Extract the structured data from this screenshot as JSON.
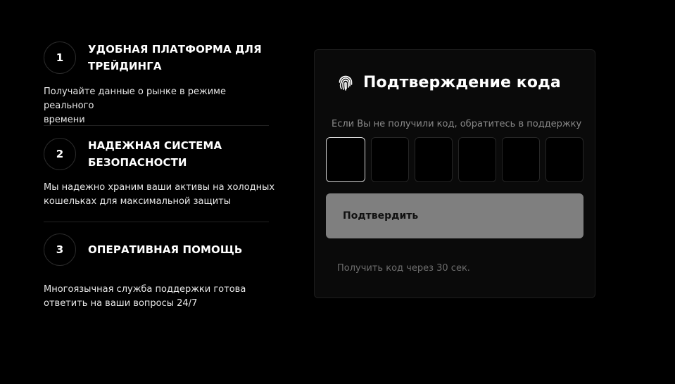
{
  "features": [
    {
      "number": "1",
      "title_line1": "УДОБНАЯ ПЛАТФОРМА ДЛЯ",
      "title_line2": "ТРЕЙДИНГА",
      "desc_line1": "Получайте данные о рынке в режиме реального",
      "desc_line2": "времени"
    },
    {
      "number": "2",
      "title_line1": "НАДЕЖНАЯ СИСТЕМА",
      "title_line2": "БЕЗОПАСНОСТИ",
      "desc_line1": "Мы надежно храним ваши активы на холодных",
      "desc_line2": "кошельках для максимальной защиты"
    },
    {
      "number": "3",
      "title_line1": "ОПЕРАТИВНАЯ ПОМОЩЬ",
      "title_line2": "",
      "desc_line1": "Многоязычная служба поддержки готова",
      "desc_line2": "ответить на ваши вопросы 24/7"
    }
  ],
  "card": {
    "icon": "fingerprint-icon",
    "title": "Подтверждение кода",
    "hint": "Если Вы не получили код, обратитесь в поддержку",
    "code_values": [
      "",
      "",
      "",
      "",
      "",
      ""
    ],
    "confirm_label": "Подтвердить",
    "resend_text": "Получить код через 30 сек."
  },
  "colors": {
    "background": "#000000",
    "card_background": "#0a0a0a",
    "button_background": "#7f7f7f",
    "hint_text": "#8a8a8a"
  }
}
